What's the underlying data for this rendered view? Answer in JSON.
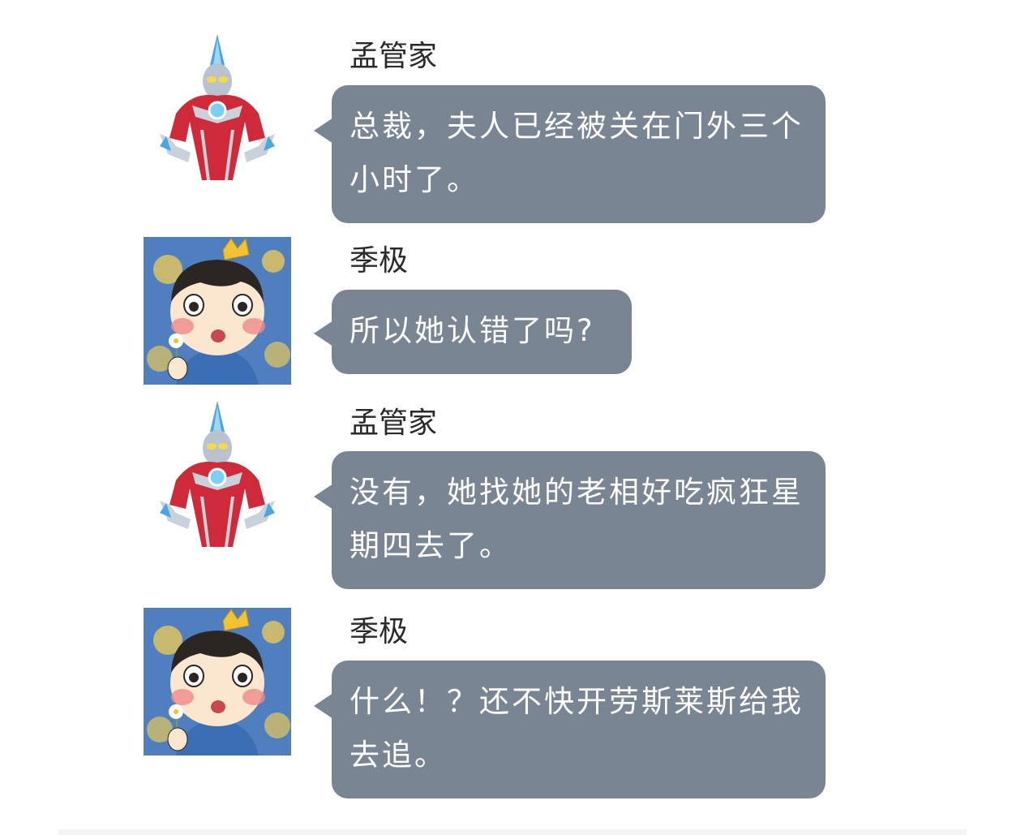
{
  "colors": {
    "bubble": "#7a8593",
    "bubble_text": "#ffffff",
    "sender_text": "#2a2a2a",
    "background": "#ffffff"
  },
  "messages": [
    {
      "sender": "孟管家",
      "avatar": "hero-avatar-icon",
      "text": "总裁，夫人已经被关在门外三个小时了。"
    },
    {
      "sender": "季极",
      "avatar": "boy-king-avatar-icon",
      "text": "所以她认错了吗?"
    },
    {
      "sender": "孟管家",
      "avatar": "hero-avatar-icon",
      "text": "没有，她找她的老相好吃疯狂星期四去了。"
    },
    {
      "sender": "季极",
      "avatar": "boy-king-avatar-icon",
      "text": "什么！？还不快开劳斯莱斯给我去追。"
    }
  ]
}
